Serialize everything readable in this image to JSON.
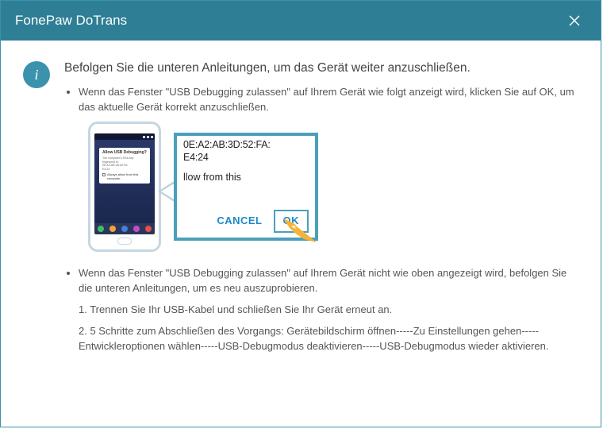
{
  "titlebar": {
    "title": "FonePaw DoTrans"
  },
  "heading": "Befolgen Sie die unteren Anleitungen, um das Gerät weiter anzuschließen.",
  "bullet1": "Wenn das Fenster \"USB Debugging zulassen\" auf Ihrem Gerät wie folgt anzeigt wird, klicken Sie auf OK, um das aktuelle Gerät korrekt anzuschließen.",
  "bullet2": "Wenn das Fenster \"USB Debugging zulassen\" auf Ihrem Gerät nicht wie oben angezeigt wird, befolgen Sie die unteren Anleitungen, um es neu auszuprobieren.",
  "step1": "1. Trennen Sie Ihr USB-Kabel und schließen Sie Ihr Gerät erneut an.",
  "step2": "2. 5 Schritte zum Abschließen des Vorgangs: Gerätebildschirm öffnen-----Zu Einstellungen gehen-----Entwickleroptionen wählen-----USB-Debugmodus deaktivieren-----USB-Debugmodus wieder aktivieren.",
  "phone_popup": {
    "title": "Allow USB Debugging?",
    "fp_label": "The computer's RSA key fingerprint is:",
    "fp_line1": "0E:A2:AB:3D:52:FA:",
    "fp_line2": "E4:24",
    "always": "Always allow from this computer"
  },
  "zoom": {
    "mac_line1": "0E:A2:AB:3D:52:FA:",
    "mac_line2": "E4:24",
    "allow_text": "llow from this",
    "cancel": "CANCEL",
    "ok": "OK"
  }
}
